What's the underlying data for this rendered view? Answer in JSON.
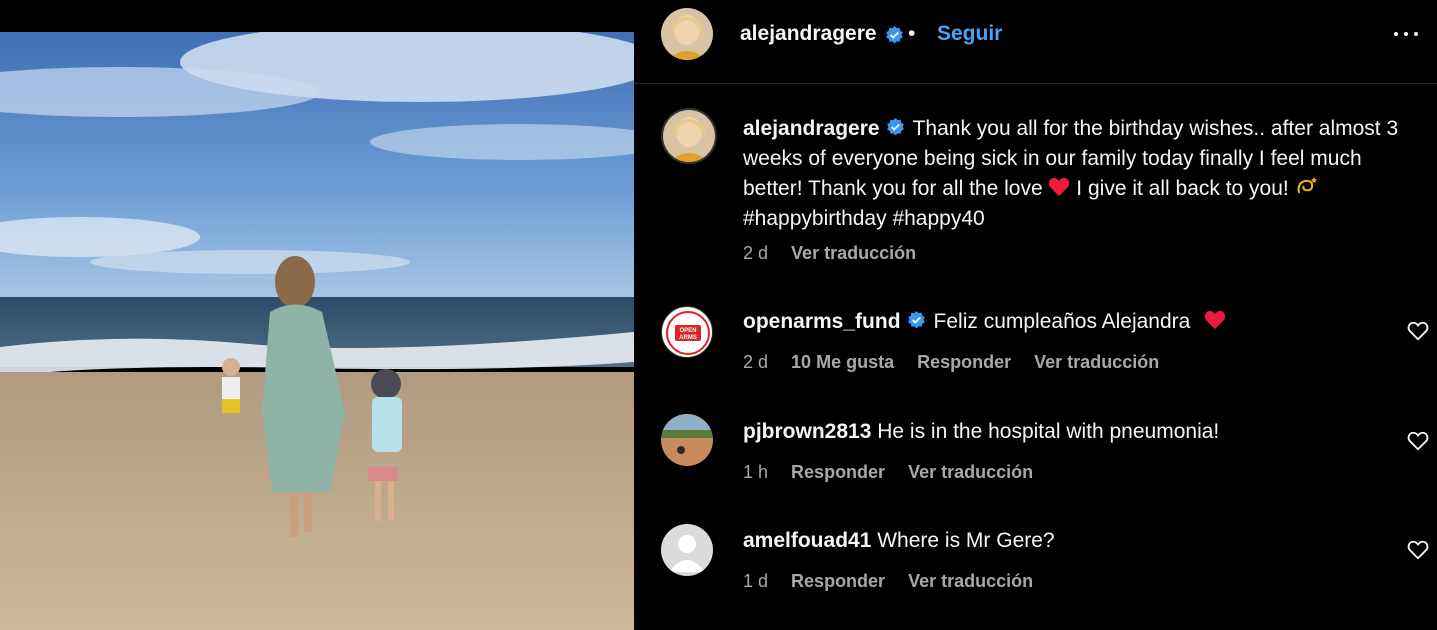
{
  "post": {
    "header": {
      "username": "alejandragere",
      "dot": "•",
      "follow_label": "Seguir"
    },
    "caption": {
      "username": "alejandragere",
      "text_1": "Thank you all for the birthday wishes.. after almost 3 weeks of everyone being sick in our family today finally I feel much better! Thank you for all the love ",
      "text_2": " I give it all back to you! ",
      "text_3": " #happybirthday #happy40",
      "time": "2 d",
      "translate_label": "Ver traducción"
    },
    "comments": [
      {
        "username": "openarms_fund",
        "text": "Feliz cumpleaños Alejandra",
        "time": "2 d",
        "likes": "10 Me gusta",
        "reply_label": "Responder",
        "translate_label": "Ver traducción",
        "avatar_text": "OPEN ARMS"
      },
      {
        "username": "pjbrown2813",
        "text": "He is in the hospital with pneumonia!",
        "time": "1 h",
        "reply_label": "Responder",
        "translate_label": "Ver traducción"
      },
      {
        "username": "amelfouad41",
        "text": "Where is Mr Gere?",
        "time": "1 d",
        "reply_label": "Responder",
        "translate_label": "Ver traducción"
      }
    ]
  },
  "colors": {
    "background": "#000000",
    "link": "#4aa3f5",
    "muted": "#a8a8a8",
    "verified": "#3897f0",
    "heart": "#ed1c3c"
  }
}
